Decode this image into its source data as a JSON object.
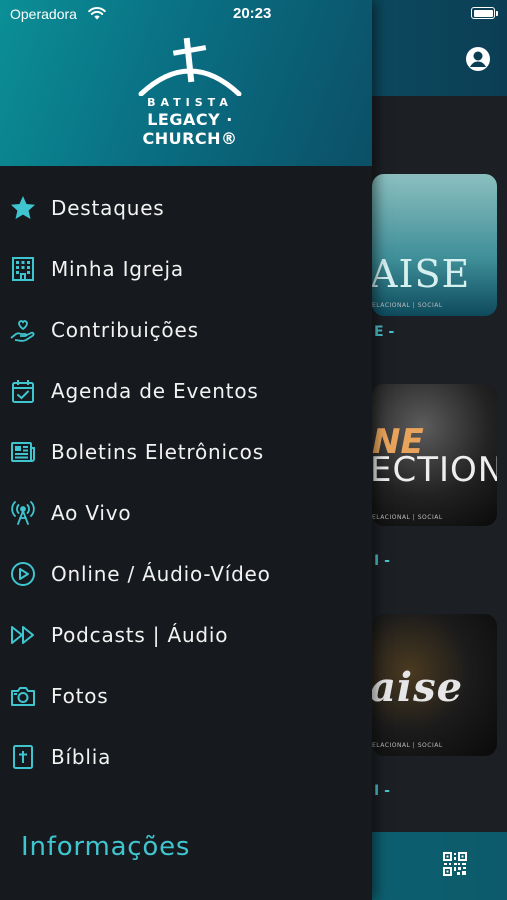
{
  "status_bar": {
    "carrier": "Operadora",
    "time": "20:23"
  },
  "background": {
    "cards": [
      {
        "main_text": "AISE",
        "sub_text": "ELACIONAL | SOCIAL",
        "caption": "E -"
      },
      {
        "main_text": "ECTION",
        "accent_text": "NE",
        "sub_text": "ELACIONAL | SOCIAL",
        "caption": "I -"
      },
      {
        "main_text": "aise",
        "sub_text": "ELACIONAL | SOCIAL",
        "caption": "I -"
      }
    ]
  },
  "drawer": {
    "logo": {
      "line1": "BATISTA",
      "line2": "LEGACY · CHURCH®"
    },
    "menu": [
      {
        "label": "Destaques",
        "icon": "star-icon"
      },
      {
        "label": "Minha Igreja",
        "icon": "building-icon"
      },
      {
        "label": "Contribuições",
        "icon": "hand-heart-icon"
      },
      {
        "label": "Agenda de Eventos",
        "icon": "calendar-check-icon"
      },
      {
        "label": "Boletins Eletrônicos",
        "icon": "newspaper-icon"
      },
      {
        "label": "Ao Vivo",
        "icon": "broadcast-icon"
      },
      {
        "label": "Online / Áudio-Vídeo",
        "icon": "play-circle-icon"
      },
      {
        "label": "Podcasts | Áudio",
        "icon": "fast-forward-icon"
      },
      {
        "label": "Fotos",
        "icon": "camera-icon"
      },
      {
        "label": "Bíblia",
        "icon": "bible-icon"
      }
    ],
    "section_title": "Informações"
  },
  "colors": {
    "accent": "#3fc5cf",
    "drawer_bg": "#16191d",
    "header_teal": "#0a6f83"
  }
}
